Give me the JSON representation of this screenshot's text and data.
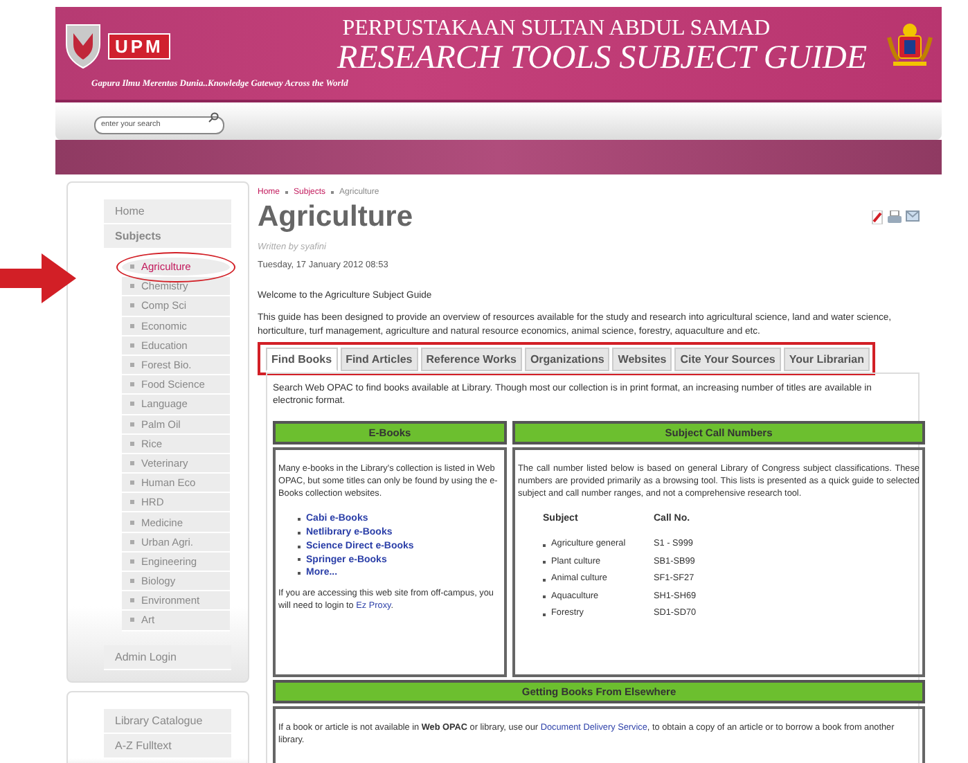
{
  "header": {
    "logo_text": "UPM",
    "title_line_1": "PERPUSTAKAAN SULTAN ABDUL SAMAD",
    "title_line_2": "RESEARCH TOOLS SUBJECT GUIDE",
    "tagline": "Gapura Ilmu Merentas Dunia..Knowledge Gateway Across the World"
  },
  "search": {
    "placeholder": "enter your search"
  },
  "sidebar": {
    "top_items": [
      "Home",
      "Subjects"
    ],
    "subjects": [
      {
        "label": "Agriculture",
        "selected": true,
        "circled": true
      },
      {
        "label": "Chemistry",
        "selected": false,
        "circled": false
      },
      {
        "label": "Comp Sci",
        "selected": false,
        "circled": false
      },
      {
        "label": "Economic",
        "selected": false,
        "circled": false
      },
      {
        "label": "Education",
        "selected": false,
        "circled": false
      },
      {
        "label": "Forest Bio.",
        "selected": false,
        "circled": false
      },
      {
        "label": "Food Science",
        "selected": false,
        "circled": false
      },
      {
        "label": "Language",
        "selected": false,
        "circled": false
      },
      {
        "label": "Palm Oil",
        "selected": false,
        "circled": false
      },
      {
        "label": "Rice",
        "selected": false,
        "circled": false
      },
      {
        "label": "Veterinary",
        "selected": false,
        "circled": false
      },
      {
        "label": "Human Eco",
        "selected": false,
        "circled": false
      },
      {
        "label": "HRD",
        "selected": false,
        "circled": false
      },
      {
        "label": "Medicine",
        "selected": false,
        "circled": false
      },
      {
        "label": "Urban Agri.",
        "selected": false,
        "circled": false
      },
      {
        "label": "Engineering",
        "selected": false,
        "circled": false
      },
      {
        "label": "Biology",
        "selected": false,
        "circled": false
      },
      {
        "label": "Environment",
        "selected": false,
        "circled": false
      },
      {
        "label": "Art",
        "selected": false,
        "circled": false
      }
    ],
    "admin": "Admin Login",
    "links": [
      "Library Catalogue",
      "A-Z Fulltext"
    ]
  },
  "annotation_arrow": true,
  "main": {
    "breadcrumb": [
      "Home",
      "Subjects",
      "Agriculture"
    ],
    "title": "Agriculture",
    "author": "Written by syafini",
    "date": "Tuesday, 17 January 2012 08:53",
    "welcome": "Welcome to the Agriculture Subject Guide",
    "intro": "This guide has been designed to provide an overview of resources available for the study and research into agricultural science, land and water science, horticulture, turf management, agriculture and natural resource economics, animal science, forestry, aquaculture and etc.",
    "tabs_highlighted": true,
    "tabs": [
      {
        "label": "Find Books",
        "selected": true
      },
      {
        "label": "Find Articles",
        "selected": false
      },
      {
        "label": "Reference Works",
        "selected": false
      },
      {
        "label": "Organizations",
        "selected": false
      },
      {
        "label": "Websites",
        "selected": false
      },
      {
        "label": "Cite Your Sources",
        "selected": false
      },
      {
        "label": "Your Librarian",
        "selected": false
      }
    ],
    "panel_intro": "Search Web OPAC to find books available at Library. Though most our collection is in print format, an increasing number of titles are available in electronic format.",
    "ebooks": {
      "heading": "E-Books",
      "text": "Many e-books in the Library's collection is listed in Web OPAC, but some titles can only be found by using the e-Books collection websites.",
      "links": [
        "Cabi e-Books",
        "Netlibrary e-Books",
        "Science Direct e-Books",
        "Springer e-Books",
        "More..."
      ],
      "access_text": "If you are accessing this web site from off-campus, you will need to login to",
      "access_link": "Ez Proxy",
      "access_end": "."
    },
    "call_numbers": {
      "heading": "Subject Call Numbers",
      "text": "The call number listed below is based on general Library of Congress subject classifications. These numbers are provided primarily as a browsing tool. This lists is presented as a quick guide to selected subject and call number ranges, and not a comprehensive research tool.",
      "columns": [
        "Subject",
        "Call No."
      ],
      "rows": [
        {
          "subject": "Agriculture general",
          "call_no": "S1 - S999"
        },
        {
          "subject": "Plant culture",
          "call_no": "SB1-SB99"
        },
        {
          "subject": "Animal culture",
          "call_no": "SF1-SF27"
        },
        {
          "subject": "Aquaculture",
          "call_no": "SH1-SH69"
        },
        {
          "subject": "Forestry",
          "call_no": "SD1-SD70"
        }
      ]
    },
    "elsewhere": {
      "heading": "Getting Books From Elsewhere",
      "text_before": "If a book or article is not available in **Web OPAC** or library, use our",
      "link": "Document Delivery Service",
      "text_after": ", to obtain a copy of an article or to borrow a book from another library."
    }
  }
}
